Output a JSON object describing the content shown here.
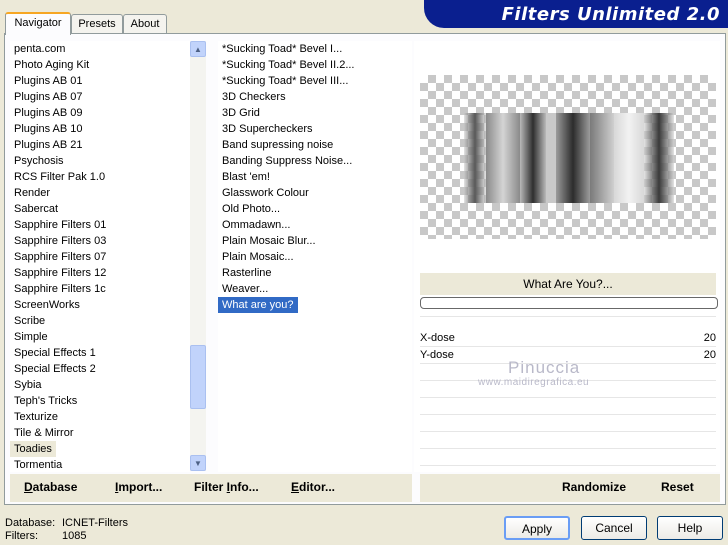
{
  "app": {
    "title": "Filters Unlimited 2.0"
  },
  "tabs": [
    {
      "label": "Navigator",
      "active": true
    },
    {
      "label": "Presets",
      "active": false
    },
    {
      "label": "About",
      "active": false
    }
  ],
  "categories": [
    "penta.com",
    "Photo Aging Kit",
    "Plugins AB 01",
    "Plugins AB 07",
    "Plugins AB 09",
    "Plugins AB 10",
    "Plugins AB 21",
    "Psychosis",
    "RCS Filter Pak 1.0",
    "Render",
    "Sabercat",
    "Sapphire Filters 01",
    "Sapphire Filters 03",
    "Sapphire Filters 07",
    "Sapphire Filters 12",
    "Sapphire Filters 1c",
    "ScreenWorks",
    "Scribe",
    "Simple",
    "Special Effects 1",
    "Special Effects 2",
    "Sybia",
    "Teph's Tricks",
    "Texturize",
    "Tile & Mirror",
    "Toadies",
    "Tormentia"
  ],
  "selected_category": "Toadies",
  "filters": [
    "*Sucking Toad*  Bevel I...",
    "*Sucking Toad*  Bevel II.2...",
    "*Sucking Toad*  Bevel III...",
    "3D Checkers",
    "3D Grid",
    "3D Supercheckers",
    "Band supressing noise",
    "Banding Suppress Noise...",
    "Blast 'em!",
    "Glasswork Colour",
    "Old Photo...",
    "Ommadawn...",
    "Plain Mosaic Blur...",
    "Plain Mosaic...",
    "Rasterline",
    "Weaver...",
    "What are you?"
  ],
  "selected_filter": "What are you?",
  "strip_buttons": {
    "database": {
      "first": "D",
      "rest": "atabase"
    },
    "import": {
      "first": "I",
      "rest": "mport..."
    },
    "filter_info": {
      "first": "Filter ",
      "u": "I",
      "rest": "nfo..."
    },
    "editor": {
      "first": "E",
      "rest": "ditor..."
    },
    "randomize": "Randomize",
    "reset": "Reset"
  },
  "preview": {
    "filter_title": "What Are You?..."
  },
  "params": [
    {
      "label": "X-dose",
      "value": "20"
    },
    {
      "label": "Y-dose",
      "value": "20"
    }
  ],
  "watermark": {
    "name": "Pinuccia",
    "url": "www.maidiregrafica.eu"
  },
  "footer": {
    "database_label": "Database:",
    "database_value": "ICNET-Filters",
    "filters_label": "Filters:",
    "filters_value": "1085"
  },
  "buttons": {
    "apply": "Apply",
    "cancel": "Cancel",
    "help": "Help"
  }
}
